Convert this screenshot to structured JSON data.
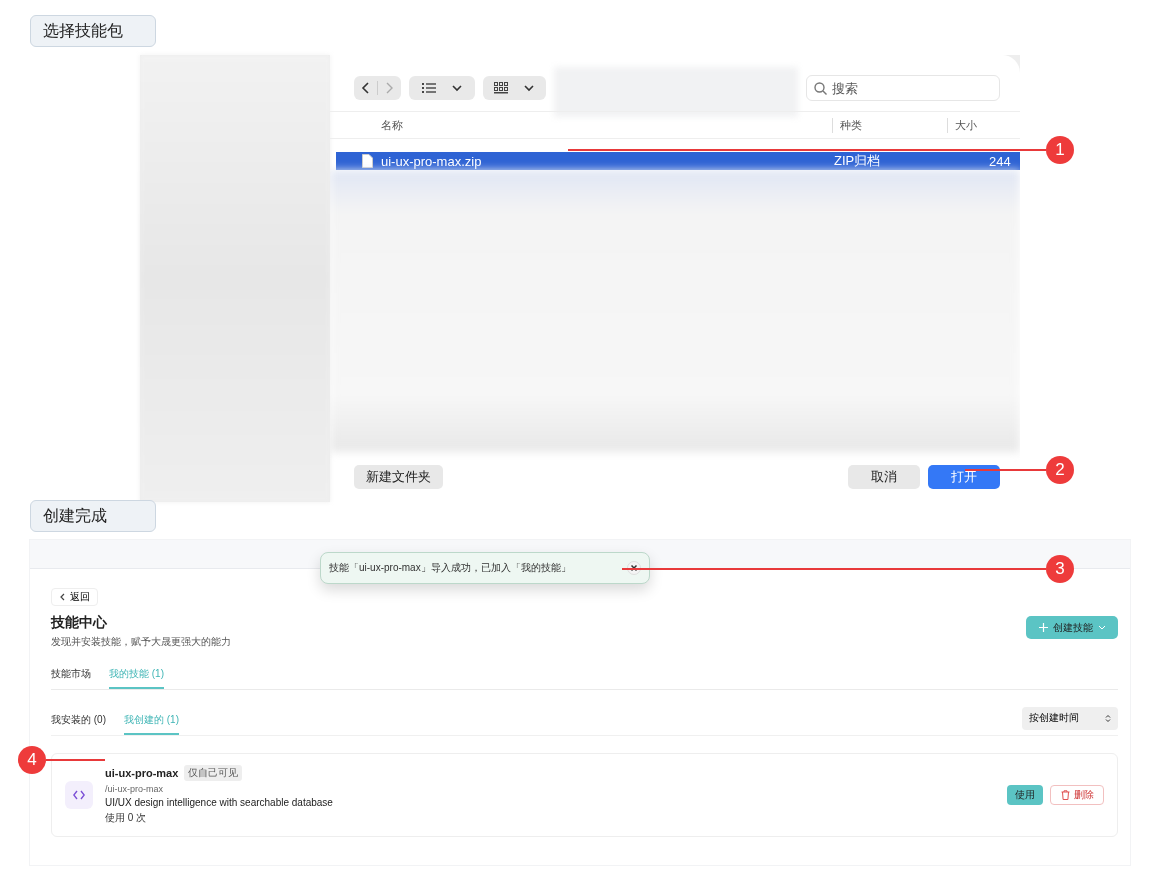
{
  "file_dialog": {
    "step_label": "选择技能包",
    "search": {
      "placeholder": "搜索"
    },
    "columns": [
      "名称",
      "种类",
      "大小"
    ],
    "files": [
      {
        "name": "ui-ux-pro-max.zip",
        "kind": "ZIP归档",
        "size": "244",
        "selected": true
      }
    ],
    "buttons": [
      {
        "label": "新建文件夹",
        "kind": "secondary"
      },
      {
        "label": "取消",
        "kind": "secondary"
      },
      {
        "label": "打开",
        "kind": "primary"
      }
    ]
  },
  "skill_center": {
    "step_label": "创建完成",
    "toast": {
      "message": "技能「ui-ux-pro-max」导入成功，已加入「我的技能」"
    },
    "back": "返回",
    "title": "技能中心",
    "subtitle": "发现并安装技能，赋予大晟更强大的能力",
    "create_button": "创建技能",
    "tabs": [
      {
        "label": "技能市场",
        "selected": false
      },
      {
        "label": "我的技能 (1)",
        "selected": true
      }
    ],
    "subtabs": [
      {
        "label": "我安装的 (0)",
        "selected": false
      },
      {
        "label": "我创建的 (1)",
        "selected": true
      }
    ],
    "sort": "按创建时间",
    "skills": [
      {
        "name": "ui-ux-pro-max",
        "visibility": "仅自己可见",
        "path": "/ui-ux-pro-max",
        "description": "UI/UX design intelligence with searchable database",
        "usage": "使用 0 次",
        "actions": [
          {
            "label": "使用",
            "kind": "use"
          },
          {
            "label": "删除",
            "kind": "delete"
          }
        ]
      }
    ]
  },
  "callouts": [
    "1",
    "2",
    "3",
    "4"
  ]
}
